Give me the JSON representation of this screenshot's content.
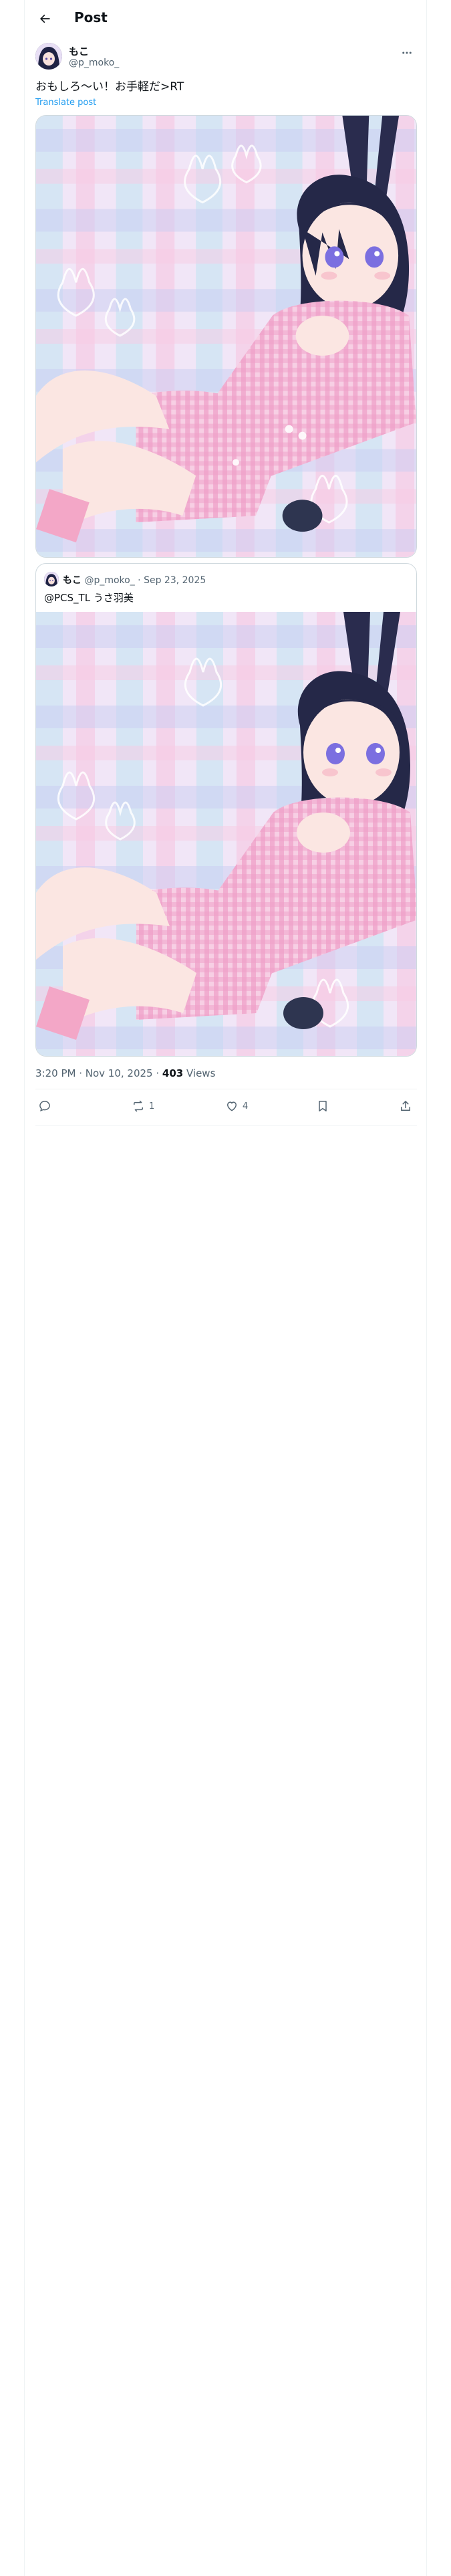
{
  "header": {
    "title": "Post"
  },
  "post": {
    "author_name": "もこ",
    "author_handle": "@p_moko_",
    "text": "おもしろ〜い！お手軽だ>RT",
    "translate_label": "Translate post",
    "image_alt": "Anime illustration: girl with long navy hair and bunny ears in a pink gingham dress on a pastel plaid background"
  },
  "quote": {
    "author_name": "もこ",
    "author_handle": "@p_moko_",
    "separator": "·",
    "date": "Sep 23, 2025",
    "text": "@PCS_TL うさ羽美"
  },
  "meta": {
    "time_date": "3:20 PM · Nov 10, 2025 · ",
    "views_count": "403",
    "views_label": " Views"
  },
  "actions": {
    "replies": "",
    "reposts": "1",
    "likes": "4"
  },
  "colors": {
    "accent": "#1d9bf0",
    "secondary_text": "#536471",
    "border": "#cfd9de"
  }
}
